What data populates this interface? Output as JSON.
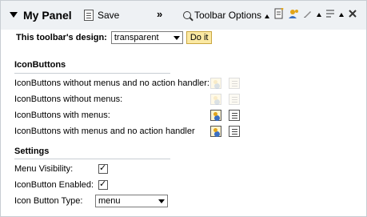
{
  "panel": {
    "title": "My Panel",
    "save_label": "Save",
    "more_label": "»",
    "toolbar_options_label": "Toolbar Options"
  },
  "design": {
    "label": "This toolbar's design:",
    "selected": "transparent",
    "doit_label": "Do it"
  },
  "iconbuttons": {
    "section_title": "IconButtons",
    "rows": [
      {
        "label": "IconButtons without menus and no action handler:"
      },
      {
        "label": "IconButtons without menus:"
      },
      {
        "label": "IconButtons with menus:"
      },
      {
        "label": "IconButtons with menus and no action handler"
      }
    ]
  },
  "settings": {
    "section_title": "Settings",
    "menu_visibility_label": "Menu Visibility:",
    "iconbutton_enabled_label": "IconButton Enabled:",
    "icon_button_type_label": "Icon Button Type:",
    "icon_button_type_value": "menu",
    "menu_visibility_checked": true,
    "iconbutton_enabled_checked": true
  }
}
